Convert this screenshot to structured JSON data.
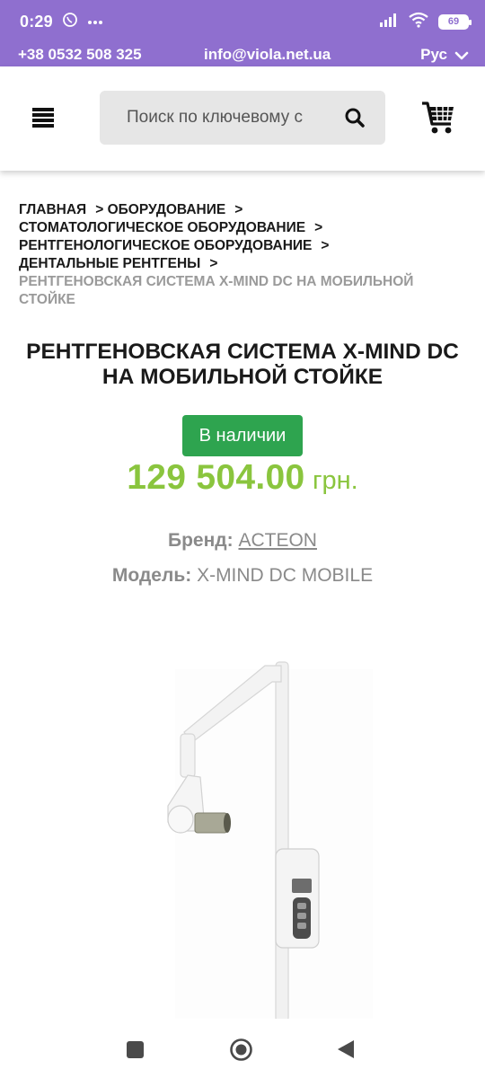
{
  "status_bar": {
    "time": "0:29",
    "battery": "69",
    "icons": [
      "viber-icon",
      "more-dots-icon",
      "signal-icon",
      "wifi-icon",
      "battery-icon"
    ]
  },
  "contact_bar": {
    "phone": "+38 0532 508 325",
    "email": "info@viola.net.ua",
    "language": "Рус"
  },
  "header": {
    "search_placeholder": "Поиск по ключевому с",
    "icons": [
      "menu-icon",
      "search-icon",
      "cart-icon"
    ]
  },
  "breadcrumb": {
    "items": [
      {
        "label": "Главная",
        "sep": ">"
      },
      {
        "label": "Оборудование",
        "sep": ">"
      },
      {
        "label": "Стоматологическое оборудование",
        "sep": ">"
      },
      {
        "label": "Рентгенологическое оборудование",
        "sep": ">"
      },
      {
        "label": "Дентальные рентгены",
        "sep": ">"
      }
    ],
    "current": "Рентгеновская система X-MIND DC на мобильной стойке"
  },
  "product": {
    "title": "Рентгеновская система X-MIND DC на мобильной стойке",
    "stock_status": "В наличии",
    "price": "129 504.00",
    "currency": "грн.",
    "brand_label": "Бренд:",
    "brand_value": "ACTEON",
    "model_label": "Модель:",
    "model_value": "X-MIND DC MOBILE"
  },
  "colors": {
    "header_purple": "#8f6fcf",
    "stock_green": "#2ea44f",
    "price_green": "#8ac53e",
    "muted_gray": "#8a8a8a"
  },
  "nav_bar": {
    "icons": [
      "recent-apps-icon",
      "home-icon",
      "back-icon"
    ]
  }
}
